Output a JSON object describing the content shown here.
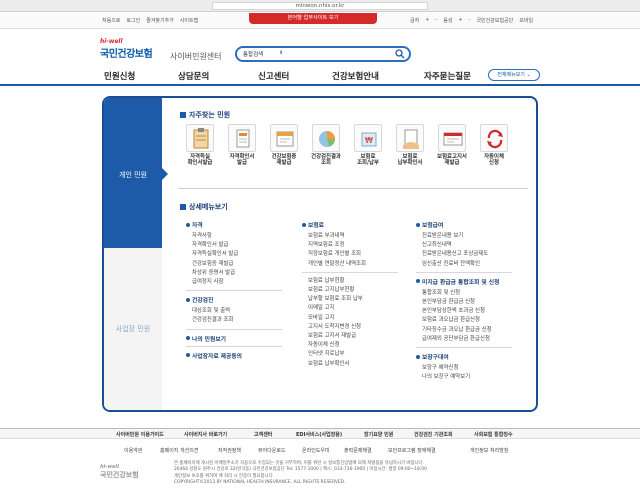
{
  "browser": {
    "url": "minwon.nhis.or.kr"
  },
  "util": {
    "left": [
      "처음으로",
      "로그인",
      "즐겨찾기추가",
      "사이트맵"
    ],
    "center_tab": "본어헬 업무사이트 보기",
    "right": [
      "글자",
      "+",
      "-",
      "음성",
      "+",
      "-",
      "국민건강보험공단",
      "모바일"
    ]
  },
  "logo": {
    "hiwell": "hi-well",
    "name": "국민건강보험",
    "center": "사이버민원센터"
  },
  "search": {
    "select": "통합검색",
    "caret": "⬍"
  },
  "gnb": {
    "items": [
      "민원신청",
      "상담문의",
      "신고센터",
      "건강보험안내",
      "자주묻는질문"
    ],
    "all_menu": "전체메뉴보기 ⌄"
  },
  "side": {
    "personal": "개인 민원",
    "business": "사업장 민원"
  },
  "quick": {
    "title": "자주찾는 민원",
    "items": [
      "자격득실\n확인서발급",
      "자격확인서\n발급",
      "건강보험증\n재발급",
      "건강검진결과\n조회",
      "보험료\n조회/납부",
      "보험료\n납부확인서",
      "보험료고지서\n재발급",
      "자동이체\n신청"
    ]
  },
  "detail": {
    "title": "상세메뉴보기",
    "col1": {
      "groups": [
        {
          "title": "자격",
          "items": [
            "자격사항",
            "자격확인서 발급",
            "자격득실확인서 발급",
            "건강보험증 재발급",
            "차상위 증명서 발급",
            "급여정지 사항"
          ]
        },
        {
          "title": "건강검진",
          "items": [
            "대상조회 및 출력",
            "건강검진결과 조회"
          ]
        },
        {
          "title": "나의 민원보기",
          "items": []
        },
        {
          "title": "사업장자료 제공동의",
          "items": []
        }
      ]
    },
    "col2": {
      "groups": [
        {
          "title": "보험료",
          "items": [
            "보험료 부과내역",
            "지역보험료 조정",
            "직장보험료 개인별 조회",
            "개인별 연말정산 내역조회"
          ]
        },
        {
          "title": "",
          "items": [
            "보험료 납부현황",
            "보험료 고지납부현황",
            "납부할 보험료 조회 납부",
            "이메일 고지",
            "모바일 고지",
            "고지서 도착지변경 신청",
            "보험료 고지서 재발급",
            "자동이체 신청",
            "인터넷 지로납부",
            "보험료 납부확인서"
          ]
        }
      ]
    },
    "col3": {
      "groups": [
        {
          "title": "보험급여",
          "items": [
            "진료받은내용 보기",
            "신고최신내역",
            "진료받은내용신고 포상금제도",
            "임신출산 진료비 잔액확인"
          ]
        },
        {
          "title": "미지급 환급금 통합조회 및 신청",
          "items": [
            "통합조회 및 신청",
            "본인부담금 환급금 신청",
            "본인부담상한액 초과금 신청",
            "보험료 과오납금 환급신청",
            "기타징수금 과오납 환급금 신청",
            "급여제외 공단부담금 환급신청"
          ]
        },
        {
          "title": "보장구대여",
          "items": [
            "보장구 예약신청",
            "나의 보장구 예약보기"
          ]
        }
      ]
    }
  },
  "footnav": [
    "사이버민원 이용가이드",
    "사이버지사 바로가기",
    "고객센터",
    "EDI서비스(사업장용)",
    "장기요양 민원",
    "건강검진 기관조회",
    "사회보험 통합징수"
  ],
  "footlinks": [
    "이용약관",
    "홈페이지 개선의견",
    "저작권정책",
    "뷰어다운로드",
    "온라인도우미",
    "출력문제해결",
    "보안프로그램 장애해결",
    "개인정보 처리방침"
  ],
  "footinfo": [
    "본 홈페이지에 게시된 이메일주소가 자동으로 수집되는 것을 거부하며, 이를 위반 시 정보통신망법에 의해 처벌됨을 유념하시기 바랍니다.",
    "26464 강원도 원주시 건강로 32(반곡동) 국민건강보험공단 Tel: 1577-1000 | 팩스: 033-736-1900 | 이용시간: 평일 09:00~18:00",
    "개인정보 보호를 위하여 매 처리 시 인증이 필요합니다.",
    "COPYRIGHT©2013 BY NATIONAL HEALTH INSURANCE. ALL RIGHTS RESERVED."
  ],
  "colors": {
    "primary": "#1d5ba8",
    "accent": "#d42a2a"
  }
}
